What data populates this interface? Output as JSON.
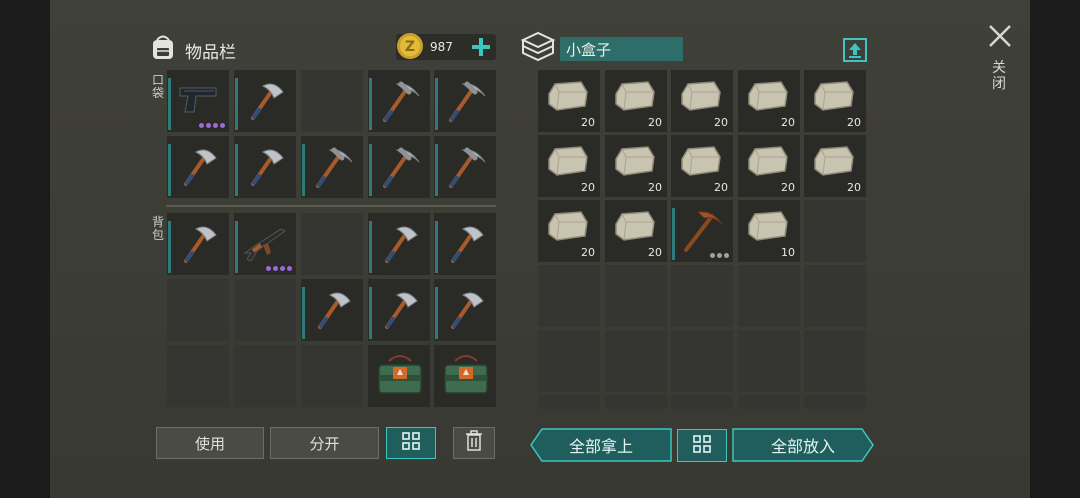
{
  "inventory": {
    "title": "物品栏",
    "currency": "987",
    "pockets_label": "口袋",
    "backpack_label": "背包",
    "pockets": [
      {
        "item": "pistol",
        "rarity_dots": 4
      },
      {
        "item": "hatchet"
      },
      {
        "item": "empty"
      },
      {
        "item": "pickaxe"
      },
      {
        "item": "pickaxe"
      },
      {
        "item": "hatchet"
      },
      {
        "item": "hatchet"
      },
      {
        "item": "pickaxe"
      },
      {
        "item": "pickaxe"
      },
      {
        "item": "pickaxe"
      }
    ],
    "backpack": [
      {
        "item": "hatchet"
      },
      {
        "item": "rifle",
        "rarity_dots": 4
      },
      {
        "item": "empty"
      },
      {
        "item": "hatchet"
      },
      {
        "item": "hatchet"
      },
      {
        "item": "empty"
      },
      {
        "item": "empty"
      },
      {
        "item": "hatchet"
      },
      {
        "item": "hatchet"
      },
      {
        "item": "hatchet"
      },
      {
        "item": "empty"
      },
      {
        "item": "empty"
      },
      {
        "item": "empty"
      },
      {
        "item": "explosive-crate"
      },
      {
        "item": "explosive-crate"
      }
    ],
    "buttons": {
      "use": "使用",
      "split": "分开"
    }
  },
  "container": {
    "name": "小盒子",
    "slots": [
      {
        "item": "stone",
        "qty": "20"
      },
      {
        "item": "stone",
        "qty": "20"
      },
      {
        "item": "stone",
        "qty": "20"
      },
      {
        "item": "stone",
        "qty": "20"
      },
      {
        "item": "stone",
        "qty": "20"
      },
      {
        "item": "stone",
        "qty": "20"
      },
      {
        "item": "stone",
        "qty": "20"
      },
      {
        "item": "stone",
        "qty": "20"
      },
      {
        "item": "stone",
        "qty": "20"
      },
      {
        "item": "stone",
        "qty": "20"
      },
      {
        "item": "stone",
        "qty": "20"
      },
      {
        "item": "stone",
        "qty": "20"
      },
      {
        "item": "bronze-pickaxe",
        "rarity_dots": 3
      },
      {
        "item": "stone",
        "qty": "10"
      },
      {
        "item": "empty"
      }
    ],
    "buttons": {
      "take_all": "全部拿上",
      "put_all": "全部放入"
    }
  },
  "close": {
    "label": "关闭"
  },
  "colors": {
    "teal": "#3cc6bf",
    "panel": "#3d3e37",
    "slot": "#2a2b27",
    "purple": "#9a6ad8",
    "gray_dot": "#a0a0a0"
  }
}
